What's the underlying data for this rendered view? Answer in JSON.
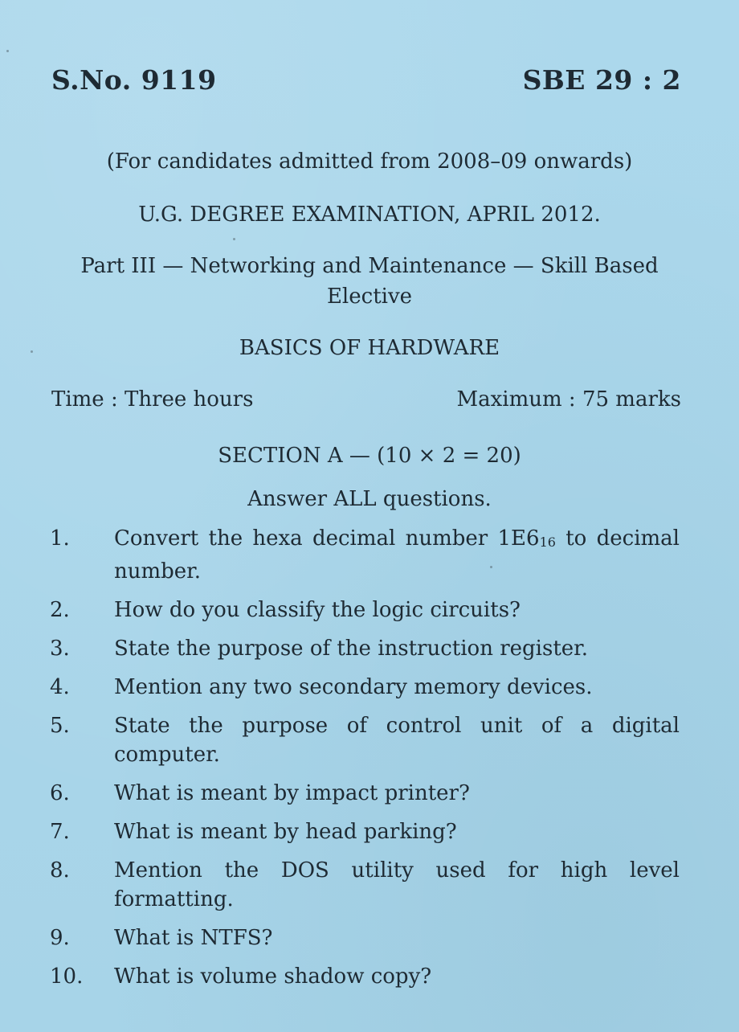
{
  "header": {
    "serial_number": "S.No. 9119",
    "paper_code": "SBE 29 : 2"
  },
  "eligibility": "(For candidates admitted from 2008–09 onwards)",
  "exam_title": "U.G. DEGREE EXAMINATION, APRIL 2012.",
  "course_line_1": "Part III — Networking and Maintenance — Skill Based",
  "course_line_2": "Elective",
  "subject": "BASICS OF HARDWARE",
  "time": "Time : Three hours",
  "max_marks": "Maximum : 75 marks",
  "section_a": {
    "title": "SECTION A — (10 × 2 = 20)",
    "instruction": "Answer ALL questions.",
    "questions": [
      {
        "number": "1.",
        "text_before": "Convert the hexa decimal number 1E6",
        "subscript": "16",
        "text_after": " to decimal number."
      },
      {
        "number": "2.",
        "text": "How do you classify the logic circuits?"
      },
      {
        "number": "3.",
        "text": "State the purpose of the instruction register."
      },
      {
        "number": "4.",
        "text": "Mention any two secondary memory devices."
      },
      {
        "number": "5.",
        "text": "State the purpose of control unit of a digital computer."
      },
      {
        "number": "6.",
        "text": "What is meant by impact printer?"
      },
      {
        "number": "7.",
        "text": "What is meant by head parking?"
      },
      {
        "number": "8.",
        "text": "Mention the DOS utility used for high level formatting."
      },
      {
        "number": "9.",
        "text": "What is NTFS?"
      },
      {
        "number": "10.",
        "text": "What is volume shadow copy?"
      }
    ]
  }
}
